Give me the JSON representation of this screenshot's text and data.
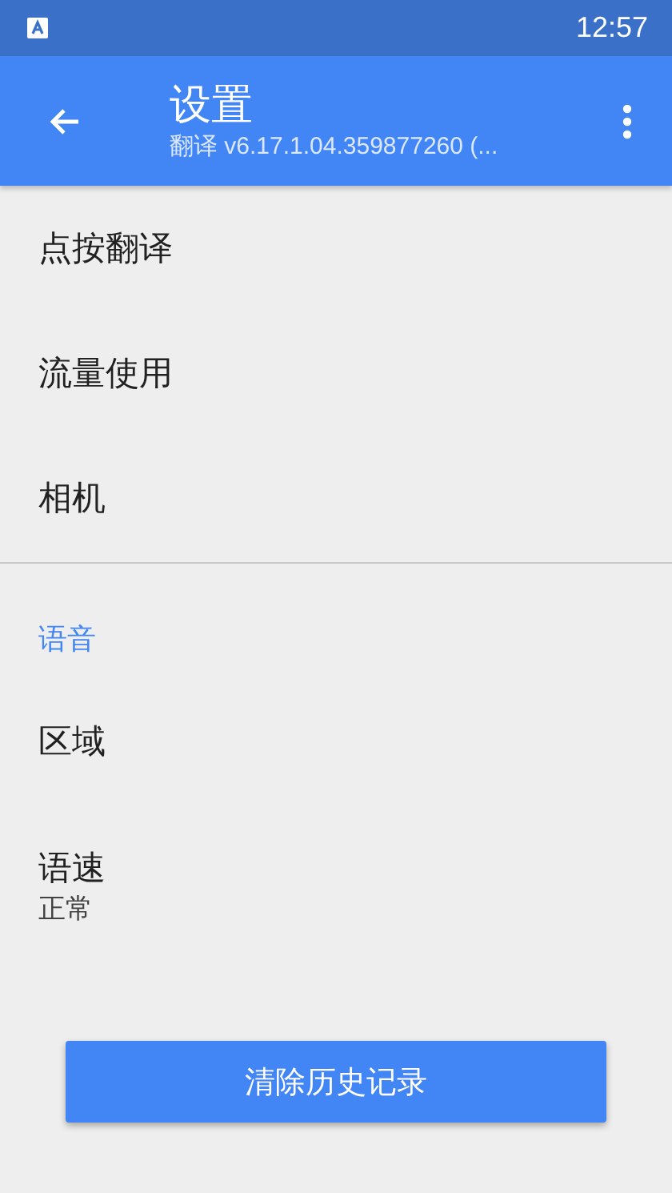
{
  "status_bar": {
    "time": "12:57"
  },
  "app_bar": {
    "title": "设置",
    "subtitle": "翻译 v6.17.1.04.359877260 (..."
  },
  "sections": [
    {
      "items": [
        {
          "title": "点按翻译"
        },
        {
          "title": "流量使用"
        },
        {
          "title": "相机"
        }
      ]
    },
    {
      "header": "语音",
      "items": [
        {
          "title": "区域"
        },
        {
          "title": "语速",
          "summary": "正常"
        }
      ]
    }
  ],
  "action_button": {
    "label": "清除历史记录"
  }
}
